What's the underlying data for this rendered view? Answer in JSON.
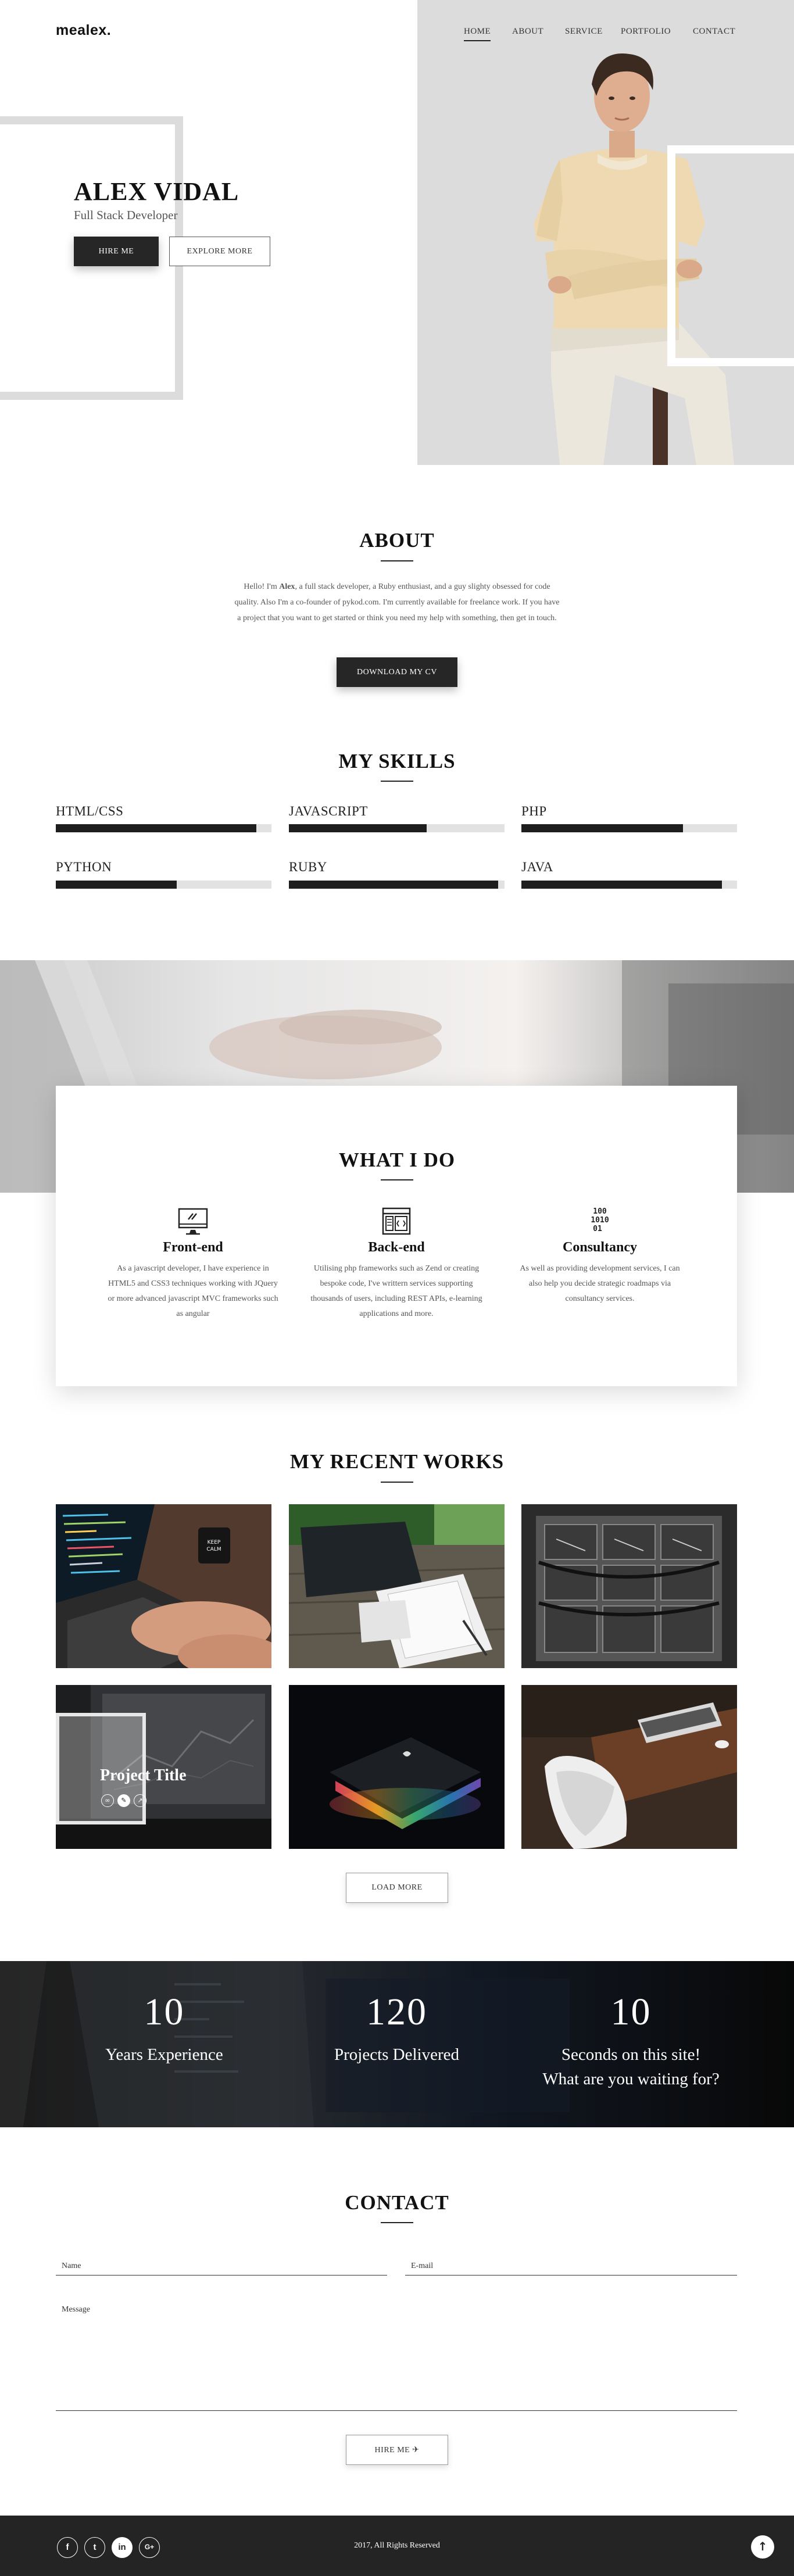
{
  "brand": {
    "logo": "mealex."
  },
  "nav": {
    "items": [
      "HOME",
      "ABOUT",
      "SERVICE",
      "PORTFOLIO",
      "CONTACT"
    ],
    "active": "HOME"
  },
  "hero": {
    "name": "ALEX VIDAL",
    "role": "Full Stack Developer",
    "primary_button": "HIRE ME",
    "secondary_button": "EXPLORE MORE"
  },
  "about": {
    "title": "ABOUT",
    "text_before": "Hello! I'm ",
    "text_name": "Alex",
    "text_after": ", a full stack developer, a Ruby enthusiast, and a guy slighty obsessed for code quality. Also I'm a co-founder of pykod.com. I'm currently available for freelance work. If you have a project that you want to get started or think you need my help with something, then get in touch.",
    "button": "DOWNLOAD MY CV"
  },
  "skills": {
    "title": "MY SKILLS",
    "items": [
      {
        "label": "HTML/CSS",
        "level": 0.93
      },
      {
        "label": "JAVASCRIPT",
        "level": 0.64
      },
      {
        "label": "PHP",
        "level": 0.75
      },
      {
        "label": "PYTHON",
        "level": 0.56
      },
      {
        "label": "RUBY",
        "level": 0.97
      },
      {
        "label": "JAVA",
        "level": 0.93
      }
    ]
  },
  "services": {
    "title": "WHAT I DO",
    "items": [
      {
        "icon": "monitor-code-icon",
        "title": "Front-end",
        "desc": "As a javascript developer, I have experience in HTML5 and CSS3 techniques working with JQuery or more advanced javascript MVC frameworks such as angular"
      },
      {
        "icon": "browser-code-icon",
        "title": "Back-end",
        "desc": "Utilising php frameworks such as Zend or creating bespoke code, I've writtern services supporting thousands of users, including REST APIs, e-learning applications and more."
      },
      {
        "icon": "binary-code-icon",
        "title": "Consultancy",
        "desc": "As well as providing development services, I can also help you decide strategic roadmaps via consultancy services."
      }
    ]
  },
  "works": {
    "title": "MY RECENT WORKS",
    "hover_title": "Project Title",
    "load_more": "LOAD MORE"
  },
  "stats": {
    "items": [
      {
        "number": "10",
        "label": "Years Experience"
      },
      {
        "number": "120",
        "label": "Projects Delivered"
      },
      {
        "number": "10",
        "label": "Seconds on this site!",
        "label2": "What are you waiting for?"
      }
    ]
  },
  "contact": {
    "title": "CONTACT",
    "name_placeholder": "Name",
    "email_placeholder": "E-mail",
    "message_placeholder": "Message",
    "submit": "HIRE ME"
  },
  "footer": {
    "social": [
      "facebook-icon",
      "twitter-icon",
      "linkedin-icon",
      "google-plus-icon"
    ],
    "social_glyphs": [
      "f",
      "t",
      "in",
      "G+"
    ],
    "copyright": "2017, All Rights Reserved",
    "to_top": "↑"
  },
  "colors": {
    "dark": "#262626",
    "light_gray": "#dcdcdc",
    "bar_track": "#e2e2e2",
    "footer": "#242424"
  }
}
